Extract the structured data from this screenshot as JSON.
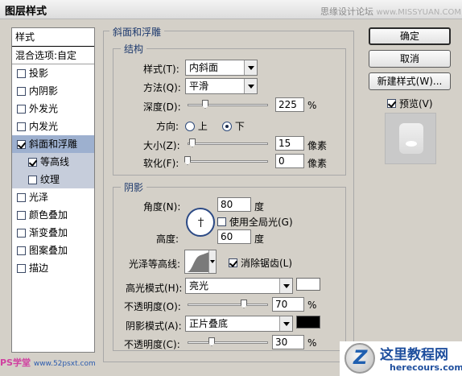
{
  "window": {
    "title": "图层样式",
    "watermark_top": "思缘设计论坛",
    "watermark_top_site": "www.MISSYUAN.COM"
  },
  "style_list": {
    "header": "样式",
    "blend_options": "混合选项:自定",
    "items": [
      {
        "label": "投影",
        "checked": false
      },
      {
        "label": "内阴影",
        "checked": false
      },
      {
        "label": "外发光",
        "checked": false
      },
      {
        "label": "内发光",
        "checked": false
      },
      {
        "label": "斜面和浮雕",
        "checked": true
      },
      {
        "label": "等高线",
        "checked": true
      },
      {
        "label": "纹理",
        "checked": false
      },
      {
        "label": "光泽",
        "checked": false
      },
      {
        "label": "颜色叠加",
        "checked": false
      },
      {
        "label": "渐变叠加",
        "checked": false
      },
      {
        "label": "图案叠加",
        "checked": false
      },
      {
        "label": "描边",
        "checked": false
      }
    ]
  },
  "buttons": {
    "ok": "确定",
    "cancel": "取消",
    "new_style": "新建样式(W)...",
    "preview": "预览(V)"
  },
  "bevel": {
    "section_title": "斜面和浮雕",
    "structure_title": "结构",
    "style_label": "样式(T):",
    "style_value": "内斜面",
    "technique_label": "方法(Q):",
    "technique_value": "平滑",
    "depth_label": "深度(D):",
    "depth_value": "225",
    "depth_unit": "%",
    "depth_fraction": 0.22,
    "direction_label": "方向:",
    "dir_up": "上",
    "dir_down": "下",
    "size_label": "大小(Z):",
    "size_value": "15",
    "size_unit": "像素",
    "size_fraction": 0.06,
    "soften_label": "软化(F):",
    "soften_value": "0",
    "soften_unit": "像素",
    "soften_fraction": 0.0
  },
  "shading": {
    "title": "阴影",
    "angle_label": "角度(N):",
    "angle_value": "80",
    "angle_unit": "度",
    "global_light_label": "使用全局光(G)",
    "altitude_label": "高度:",
    "altitude_value": "60",
    "altitude_unit": "度",
    "gloss_label": "光泽等高线:",
    "antialias_label": "消除锯齿(L)",
    "highlight_mode_label": "高光模式(H):",
    "highlight_mode_value": "亮光",
    "highlight_color": "#ffffff",
    "highlight_opacity_label": "不透明度(O):",
    "highlight_opacity_value": "70",
    "highlight_opacity_unit": "%",
    "highlight_opacity_fraction": 0.7,
    "shadow_mode_label": "阴影模式(A):",
    "shadow_mode_value": "正片叠底",
    "shadow_color": "#000000",
    "shadow_opacity_label": "不透明度(C):",
    "shadow_opacity_value": "30",
    "shadow_opacity_unit": "%",
    "shadow_opacity_fraction": 0.3
  },
  "watermarks": {
    "bottom_left": "PS学堂",
    "bottom_left_site": "www.52psxt.com",
    "bottom_right_cn": "这里教程网",
    "bottom_right_en": "herecours.com"
  }
}
